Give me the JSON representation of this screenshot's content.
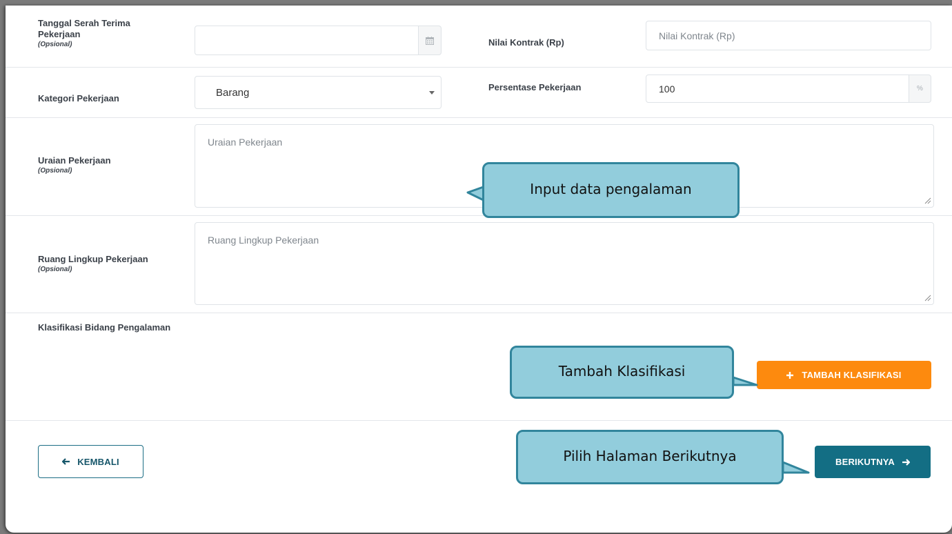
{
  "form": {
    "handover_date": {
      "label_line1": "Tanggal Serah Terima",
      "label_line2": "Pekerjaan",
      "optional": "(Opsional)",
      "value": ""
    },
    "contract_value": {
      "label": "Nilai Kontrak (Rp)",
      "placeholder": "Nilai Kontrak (Rp)"
    },
    "job_category": {
      "label": "Kategori Pekerjaan",
      "selected": "Barang"
    },
    "job_percentage": {
      "label": "Persentase Pekerjaan",
      "value": "100",
      "suffix": "%"
    },
    "job_description": {
      "label": "Uraian Pekerjaan",
      "optional": "(Opsional)",
      "placeholder": "Uraian Pekerjaan"
    },
    "job_scope": {
      "label": "Ruang Lingkup Pekerjaan",
      "optional": "(Opsional)",
      "placeholder": "Ruang Lingkup Pekerjaan"
    },
    "classification": {
      "label": "Klasifikasi Bidang Pengalaman"
    }
  },
  "buttons": {
    "add_classification": "TAMBAH KLASIFIKASI",
    "back": "KEMBALI",
    "next": "BERIKUTNYA"
  },
  "callouts": {
    "input_data": "Input data pengalaman",
    "add_classification": "Tambah Klasifikasi",
    "next_page": "Pilih Halaman Berikutnya"
  },
  "icons": {
    "calendar": "calendar-icon",
    "plus": "plus-icon",
    "arrow_left": "arrow-left-icon",
    "arrow_right": "arrow-right-icon",
    "caret": "chevron-down-icon"
  },
  "colors": {
    "orange_button": "#fd8a0e",
    "teal_button": "#136e84",
    "callout_fill": "#92cddc",
    "callout_border": "#31859c"
  }
}
